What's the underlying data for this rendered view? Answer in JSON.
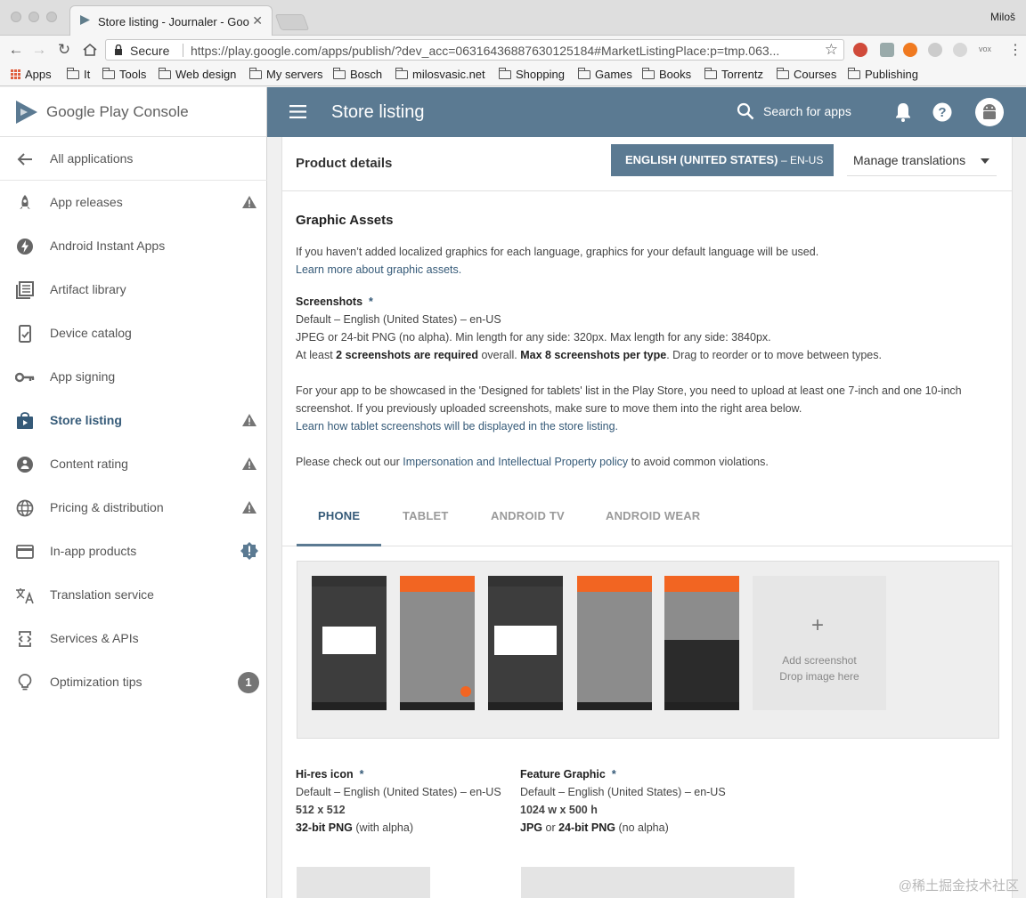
{
  "browser": {
    "tab_title": "Store listing - Journaler - Goo",
    "tab_close": "✕",
    "user": "Miloš",
    "secure_label": "Secure",
    "url": "https://play.google.com/apps/publish/?dev_acc=06316436887630125184#MarketListingPlace:p=tmp.063...",
    "bookmarks": [
      "Apps",
      "It",
      "Tools",
      "Web design",
      "My servers",
      "Bosch",
      "milosvasic.net",
      "Shopping",
      "Games",
      "Books",
      "Torrentz",
      "Courses",
      "Publishing"
    ],
    "ext_label": "vox"
  },
  "brand": {
    "name": "Google Play Console"
  },
  "sidebar": {
    "items": [
      {
        "label": "All applications",
        "icon": "arrow-back-icon"
      },
      {
        "label": "App releases",
        "icon": "rocket-icon",
        "indicator": "warning"
      },
      {
        "label": "Android Instant Apps",
        "icon": "flash-icon"
      },
      {
        "label": "Artifact library",
        "icon": "library-icon"
      },
      {
        "label": "Device catalog",
        "icon": "device-icon"
      },
      {
        "label": "App signing",
        "icon": "key-icon"
      },
      {
        "label": "Store listing",
        "icon": "store-icon",
        "indicator": "warning",
        "active": true
      },
      {
        "label": "Content rating",
        "icon": "content-rating-icon",
        "indicator": "warning"
      },
      {
        "label": "Pricing & distribution",
        "icon": "globe-icon",
        "indicator": "warning"
      },
      {
        "label": "In-app products",
        "icon": "credit-card-icon",
        "indicator": "alert"
      },
      {
        "label": "Translation service",
        "icon": "translate-icon"
      },
      {
        "label": "Services & APIs",
        "icon": "api-icon"
      },
      {
        "label": "Optimization tips",
        "icon": "lightbulb-icon",
        "badge": "1"
      }
    ]
  },
  "appbar": {
    "title": "Store listing",
    "search_placeholder": "Search for apps"
  },
  "product": {
    "heading": "Product details",
    "language_button": "ENGLISH (UNITED STATES)",
    "language_code": "– EN-US",
    "manage_translations": "Manage translations"
  },
  "graphic": {
    "heading": "Graphic Assets",
    "intro": "If you haven’t added localized graphics for each language, graphics for your default language will be used.",
    "learn_more": "Learn more about graphic assets.",
    "screenshots_title": "Screenshots",
    "required_mark": "*",
    "default_lang": "Default – English (United States) – en-US",
    "format_note": "JPEG or 24-bit PNG (no alpha). Min length for any side: 320px. Max length for any side: 3840px.",
    "atleast_prefix": "At least ",
    "atleast_bold": "2 screenshots are required",
    "atleast_mid": " overall. ",
    "max_bold": "Max 8 screenshots per type",
    "atleast_suffix": ". Drag to reorder or to move between types.",
    "tablet_note1": "For your app to be showcased in the 'Designed for tablets' list in the Play Store, you need to upload at least one 7-inch and one 10-inch",
    "tablet_note2": "screenshot. If you previously uploaded screenshots, make sure to move them into the right area below.",
    "tablet_link": "Learn how tablet screenshots will be displayed in the store listing.",
    "policy_prefix": "Please check out our ",
    "policy_link": "Impersonation and Intellectual Property policy",
    "policy_suffix": " to avoid common violations."
  },
  "tabs": [
    "PHONE",
    "TABLET",
    "ANDROID TV",
    "ANDROID WEAR"
  ],
  "screenshots": {
    "add_label": "Add screenshot",
    "drop_label": "Drop image here",
    "plus": "+"
  },
  "hires": {
    "title": "Hi-res icon",
    "default_lang": "Default – English (United States) – en-US",
    "size": "512 x 512",
    "format_bold": "32-bit PNG",
    "format_rest": " (with alpha)"
  },
  "feature": {
    "title": "Feature Graphic",
    "default_lang": "Default – English (United States) – en-US",
    "size": "1024 w x 500 h",
    "format_bold1": "JPG",
    "format_mid": " or ",
    "format_bold2": "24-bit PNG",
    "format_rest": " (no alpha)"
  },
  "watermark": "@稀土掘金技术社区",
  "colors": {
    "accent": "#5b7a92",
    "link": "#355a78",
    "warning": "#757575"
  }
}
